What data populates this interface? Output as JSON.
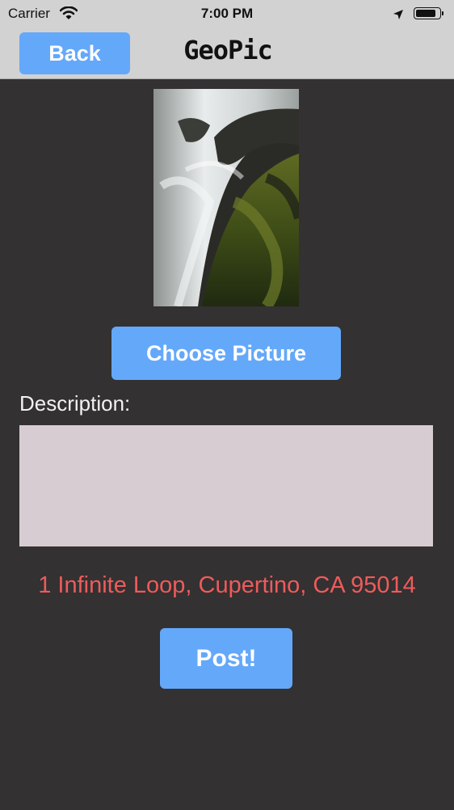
{
  "status_bar": {
    "carrier": "Carrier",
    "time": "7:00 PM",
    "battery_level": 0.9
  },
  "nav": {
    "back_label": "Back",
    "title": "GeoPic"
  },
  "picture": {
    "choose_label": "Choose Picture"
  },
  "description": {
    "label": "Description:",
    "value": "",
    "background_color": "#d8ccd3"
  },
  "location": {
    "address": "1 Infinite Loop, Cupertino, CA 95014",
    "color": "#ef5b5b"
  },
  "actions": {
    "post_label": "Post!"
  },
  "colors": {
    "accent": "#64a8fa",
    "background": "#333132",
    "bars": "#d2d2d2"
  },
  "icons": [
    "wifi-icon",
    "location-arrow-icon",
    "battery-icon"
  ]
}
